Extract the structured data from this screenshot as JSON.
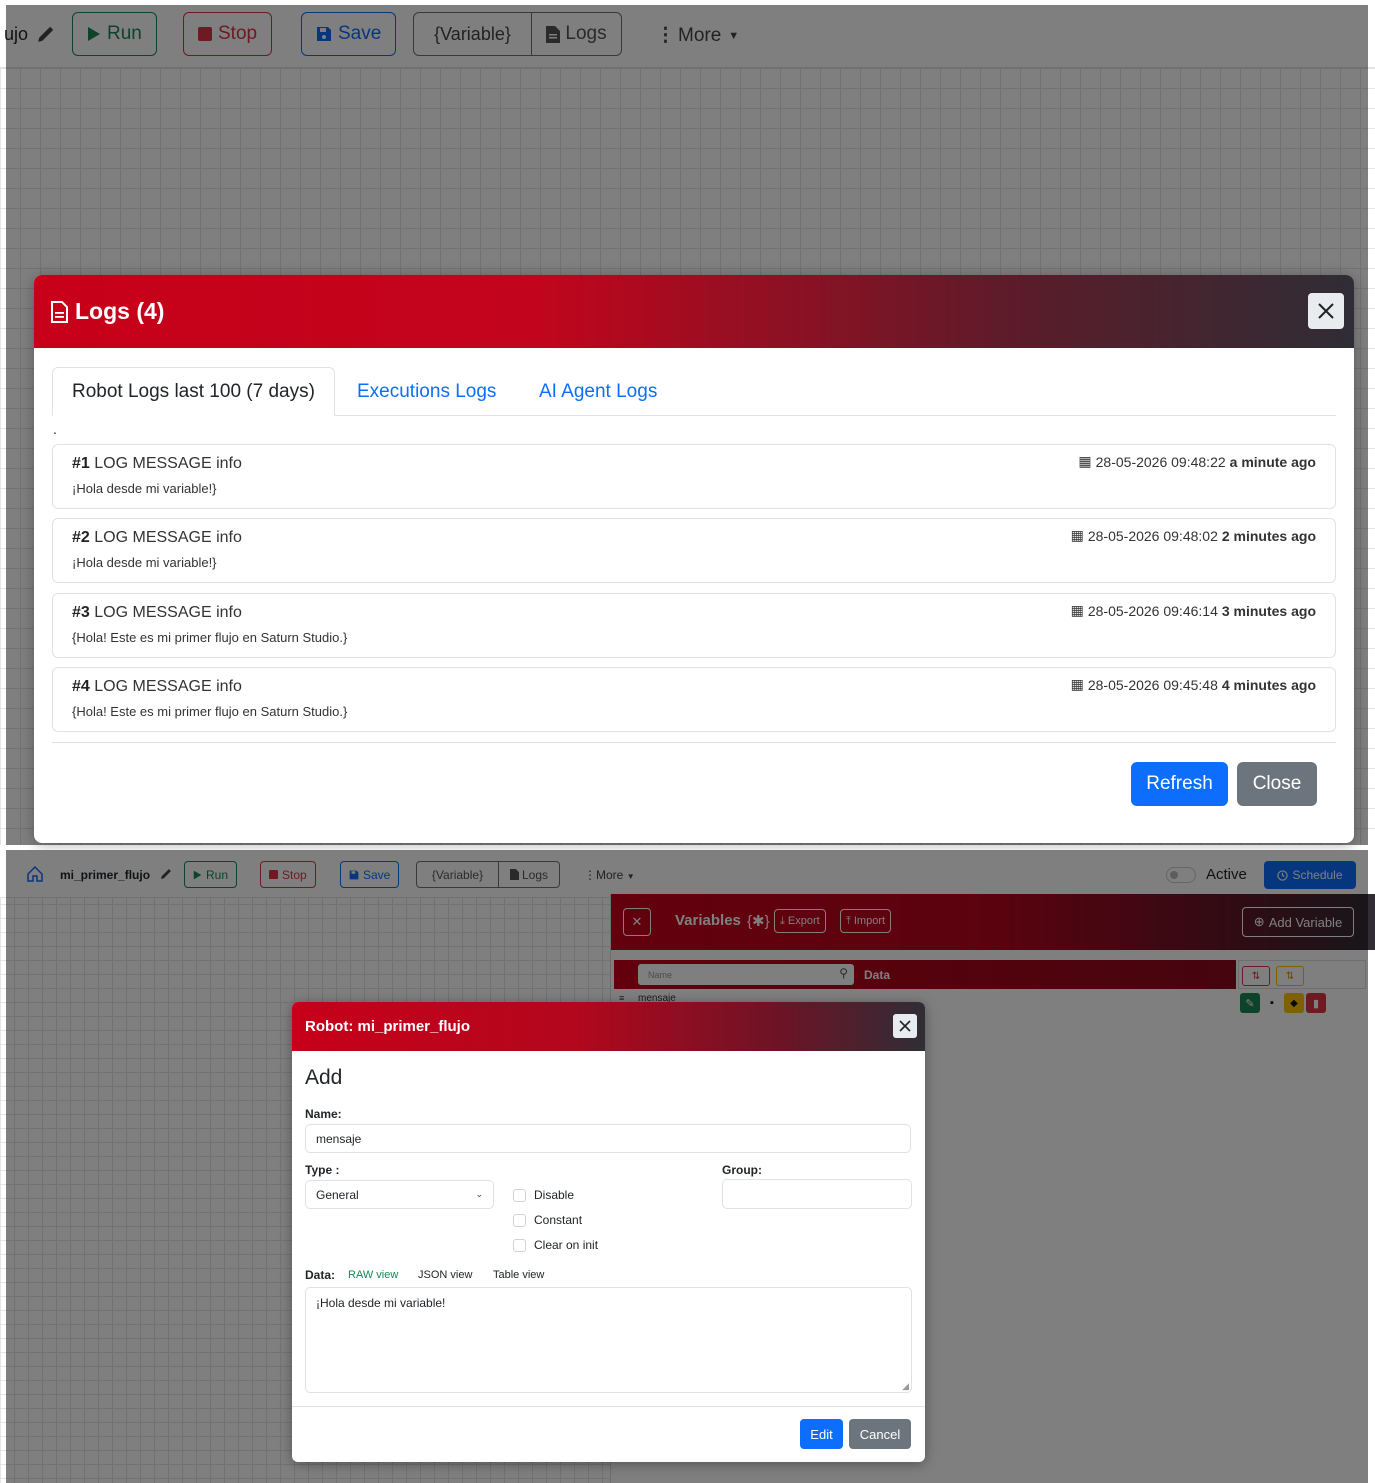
{
  "toolbar": {
    "title_fragment": "ujo",
    "run_label": "Run",
    "stop_label": "Stop",
    "save_label": "Save",
    "variable_label": "{Variable}",
    "logs_label": "Logs",
    "more_label": "More"
  },
  "logs_modal": {
    "title": "Logs (4)",
    "tabs": [
      {
        "label": "Robot Logs last 100 (7 days)",
        "active": true
      },
      {
        "label": "Executions Logs",
        "active": false
      },
      {
        "label": "AI Agent Logs",
        "active": false
      }
    ],
    "dot": ".",
    "entries": [
      {
        "num": "#1",
        "title": "LOG MESSAGE info",
        "message": "¡Hola desde mi variable!}",
        "date": "28-05-2026 09:48:22",
        "ago": "a minute ago"
      },
      {
        "num": "#2",
        "title": "LOG MESSAGE info",
        "message": "¡Hola desde mi variable!}",
        "date": "28-05-2026 09:48:02",
        "ago": "2 minutes ago"
      },
      {
        "num": "#3",
        "title": "LOG MESSAGE info",
        "message": "{Hola! Este es mi primer flujo en Saturn Studio.}",
        "date": "28-05-2026 09:46:14",
        "ago": "3 minutes ago"
      },
      {
        "num": "#4",
        "title": "LOG MESSAGE info",
        "message": "{Hola! Este es mi primer flujo en Saturn Studio.}",
        "date": "28-05-2026 09:45:48",
        "ago": "4 minutes ago"
      }
    ],
    "refresh_label": "Refresh",
    "close_label": "Close"
  },
  "bg_toolbar": {
    "robot_name": "mi_primer_flujo",
    "run_label": "Run",
    "stop_label": "Stop",
    "save_label": "Save",
    "variable_label": "{Variable}",
    "logs_label": "Logs",
    "more_label": "More",
    "active_label": "Active",
    "schedule_label": "Schedule"
  },
  "variables_panel": {
    "title": "Variables",
    "title_suffix": "{✱}",
    "export_label": "Export",
    "import_label": "Import",
    "add_label": "Add Variable",
    "search_placeholder": "Name",
    "data_header": "Data",
    "row_name": "mensaje"
  },
  "variable_modal": {
    "title": "Robot: mi_primer_flujo",
    "heading": "Add",
    "name_label": "Name:",
    "name_value": "mensaje",
    "type_label": "Type :",
    "type_value": "General",
    "group_label": "Group:",
    "group_value": "",
    "checkboxes": [
      "Disable",
      "Constant",
      "Clear on init"
    ],
    "data_label": "Data:",
    "views": [
      "RAW view",
      "JSON view",
      "Table view"
    ],
    "data_value": "¡Hola desde mi variable!",
    "edit_label": "Edit",
    "cancel_label": "Cancel"
  },
  "colors": {
    "brand_red": "#c8001a",
    "primary": "#0d6efd",
    "success": "#198754",
    "danger": "#dc3545",
    "secondary": "#6c757d"
  }
}
